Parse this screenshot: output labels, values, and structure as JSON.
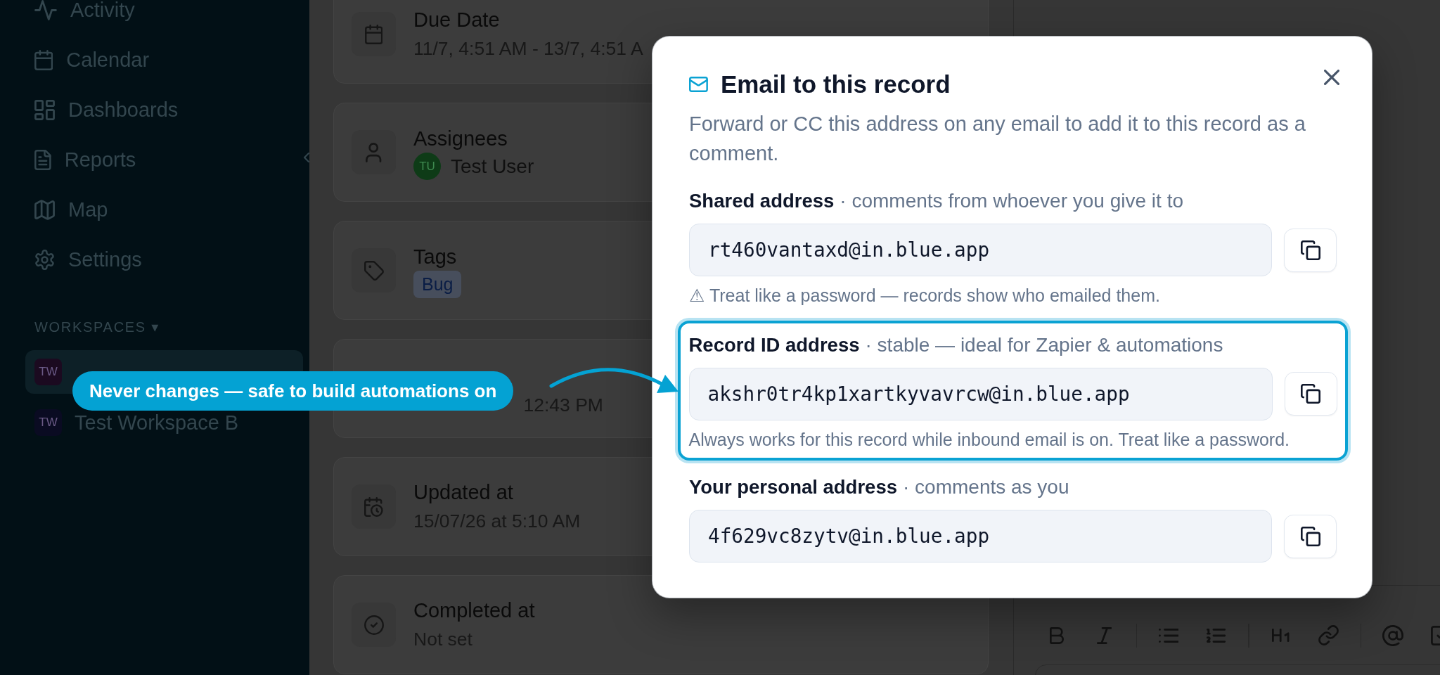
{
  "sidebar": {
    "nav_items": [
      {
        "label": "Activity",
        "selected": false
      },
      {
        "label": "Calendar",
        "selected": false
      },
      {
        "label": "Dashboards",
        "selected": false
      },
      {
        "label": "Reports",
        "selected": false
      },
      {
        "label": "Map",
        "selected": false
      },
      {
        "label": "Settings",
        "selected": false
      }
    ],
    "workspaces_heading": "WORKSPACES ▾",
    "workspaces": [
      {
        "badge": "TW",
        "color": "#1b0a20",
        "selected": true
      },
      {
        "badge": "TW",
        "name": "Test Workspace B",
        "color": "#0a0b22",
        "selected": false
      }
    ]
  },
  "details": {
    "cards": [
      {
        "kind": "text",
        "label": "Due Date",
        "value": "11/7, 4:51 AM - 13/7, 4:51 A"
      },
      {
        "kind": "person",
        "label": "Assignees",
        "avatar": "TU",
        "value": "Test User"
      },
      {
        "kind": "tags",
        "label": "Tags",
        "tags": [
          "Bug"
        ]
      },
      {
        "kind": "partial",
        "value": "12:43 PM"
      },
      {
        "kind": "text",
        "label": "Updated at",
        "value": "15/07/26 at 5:10 AM"
      },
      {
        "kind": "text",
        "label": "Completed at",
        "value": "Not set"
      }
    ]
  },
  "modal": {
    "title": "Email to this record",
    "description": "Forward or CC this address on any email to add it to this record as a comment.",
    "addresses": [
      {
        "label": "Shared address",
        "hint": "· comments from whoever you give it to",
        "value": "rt460vantaxd@in.blue.app",
        "note": "⚠ Treat like a password — records show who emailed them.",
        "highlighted": false
      },
      {
        "label": "Record ID address",
        "hint": "· stable — ideal for Zapier & automations",
        "value": "akshr0tr4kp1xartkyvavrcw@in.blue.app",
        "note": "Always works for this record while inbound email is on. Treat like a password.",
        "highlighted": true
      },
      {
        "label": "Your personal address",
        "hint": "· comments as you",
        "value": "4f629vc8zytv@in.blue.app",
        "highlighted": false
      }
    ]
  },
  "callout": {
    "text": "Never changes — safe to build automations on"
  }
}
